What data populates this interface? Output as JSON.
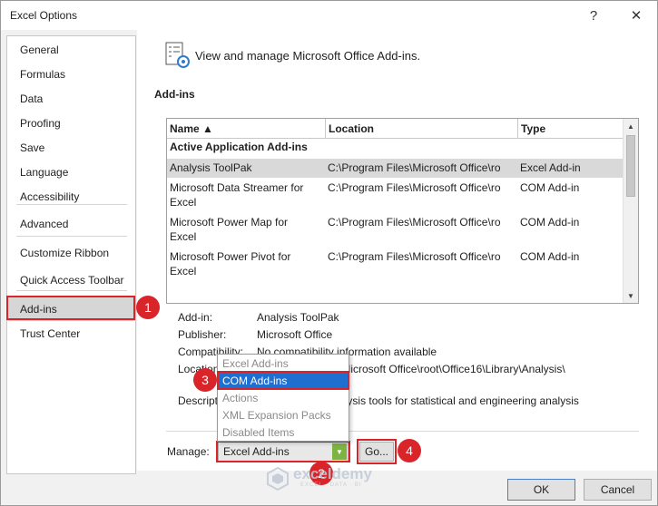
{
  "window": {
    "title": "Excel Options",
    "help_glyph": "?",
    "close_glyph": "✕"
  },
  "sidebar": {
    "items": [
      {
        "label": "General"
      },
      {
        "label": "Formulas"
      },
      {
        "label": "Data"
      },
      {
        "label": "Proofing"
      },
      {
        "label": "Save"
      },
      {
        "label": "Language"
      },
      {
        "label": "Accessibility"
      },
      {
        "label": "Advanced"
      },
      {
        "label": "Customize Ribbon"
      },
      {
        "label": "Quick Access Toolbar"
      },
      {
        "label": "Add-ins"
      },
      {
        "label": "Trust Center"
      }
    ],
    "selected": "Add-ins"
  },
  "main": {
    "heading": "View and manage Microsoft Office Add-ins.",
    "section_title": "Add-ins",
    "table": {
      "columns": [
        "Name ▲",
        "Location",
        "Type"
      ],
      "group_label": "Active Application Add-ins",
      "rows": [
        {
          "name_line1": "Analysis ToolPak",
          "name_line2": "",
          "location": "C:\\Program Files\\Microsoft Office\\ro",
          "type": "Excel Add-in"
        },
        {
          "name_line1": "Microsoft Data Streamer for",
          "name_line2": "Excel",
          "location": "C:\\Program Files\\Microsoft Office\\ro",
          "type": "COM Add-in"
        },
        {
          "name_line1": "Microsoft Power Map for",
          "name_line2": "Excel",
          "location": "C:\\Program Files\\Microsoft Office\\ro",
          "type": "COM Add-in"
        },
        {
          "name_line1": "Microsoft Power Pivot for",
          "name_line2": "Excel",
          "location": "C:\\Program Files\\Microsoft Office\\ro",
          "type": "COM Add-in"
        }
      ]
    },
    "details": {
      "addin_label": "Add-in:",
      "addin_value": "Analysis ToolPak",
      "publisher_label": "Publisher:",
      "publisher_value": "Microsoft Office",
      "compat_label": "Compatibility:",
      "compat_value": "No compatibility information available",
      "location_label": "Location:",
      "location_value": "C:\\Program Files\\Microsoft Office\\root\\Office16\\Library\\Analysis\\",
      "desc_label": "Description:",
      "desc_value": "Provides data analysis tools for statistical and engineering analysis"
    },
    "manage": {
      "label": "Manage:",
      "selected": "Excel Add-ins",
      "options": [
        "Excel Add-ins",
        "COM Add-ins",
        "Actions",
        "XML Expansion Packs",
        "Disabled Items"
      ],
      "highlighted_option": "COM Add-ins",
      "go_label": "Go..."
    }
  },
  "footer": {
    "ok_label": "OK",
    "cancel_label": "Cancel"
  },
  "annotations": {
    "badge_1": "1",
    "badge_2": "2",
    "badge_3": "3",
    "badge_4": "4",
    "highlight_color": "#d9242a"
  },
  "watermark": {
    "text": "exceldemy",
    "subtext": "EXCEL · DATA · BI"
  },
  "colors": {
    "selection_blue": "#1e6fd0",
    "dropdown_arrow_green": "#7cb342"
  }
}
